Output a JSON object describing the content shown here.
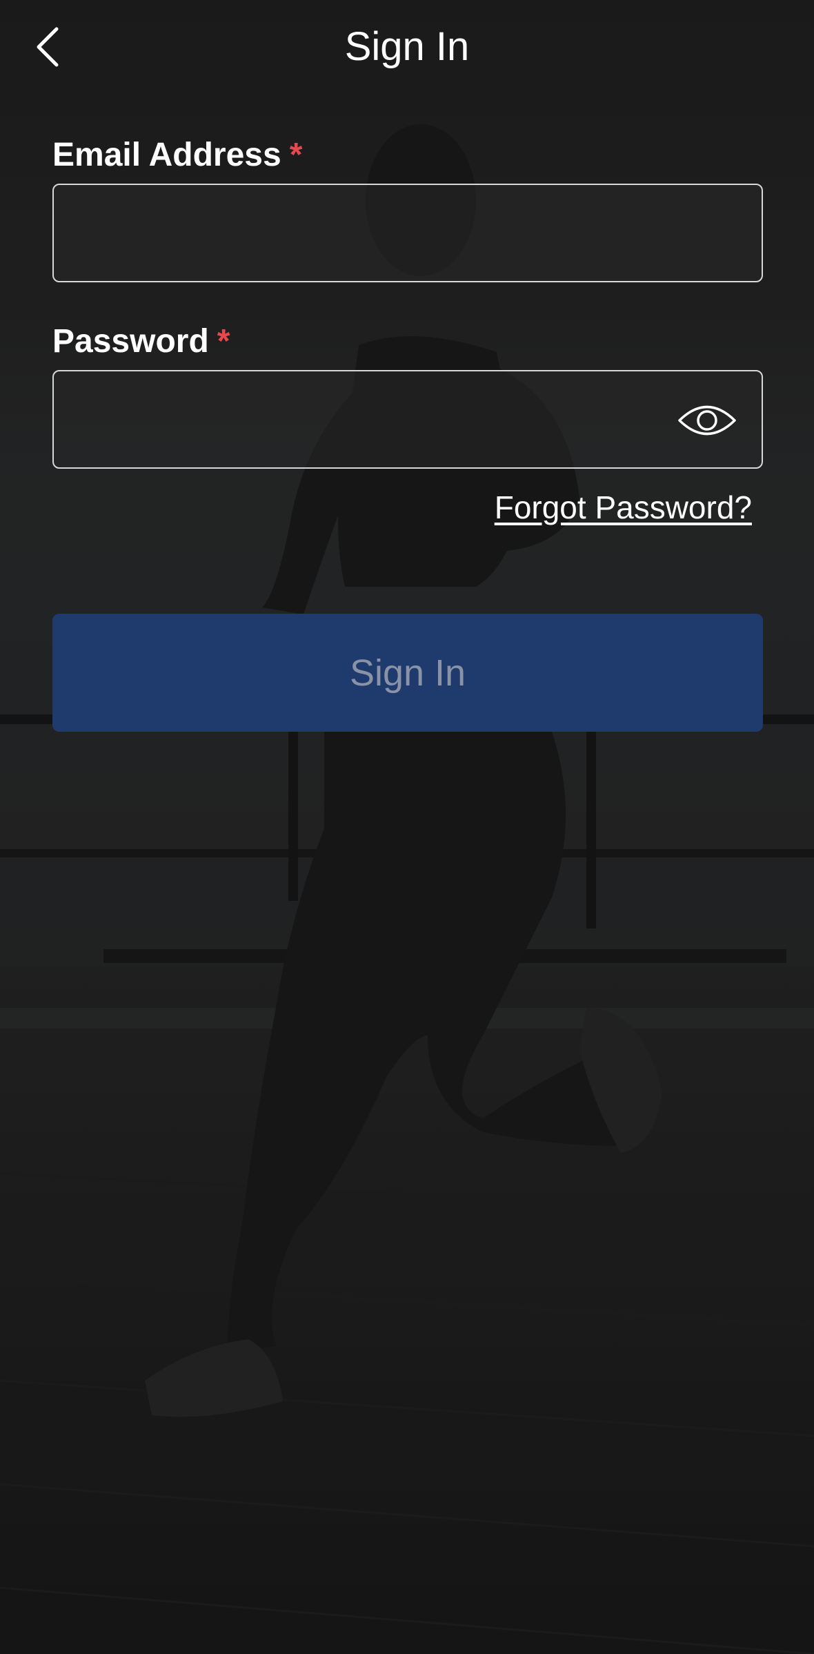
{
  "header": {
    "title": "Sign In",
    "back_icon": "chevron-left-icon"
  },
  "form": {
    "email": {
      "label": "Email Address",
      "required_mark": "*",
      "value": "",
      "placeholder": ""
    },
    "password": {
      "label": "Password",
      "required_mark": "*",
      "value": "",
      "placeholder": "",
      "toggle_icon": "eye-icon"
    },
    "forgot_password": "Forgot Password?",
    "submit_label": "Sign In"
  },
  "colors": {
    "required": "#e5484d",
    "button_bg": "#1f3b6e",
    "button_text": "#8a93a6",
    "text": "#ffffff"
  },
  "background": {
    "description_icon": "runner-photo"
  }
}
